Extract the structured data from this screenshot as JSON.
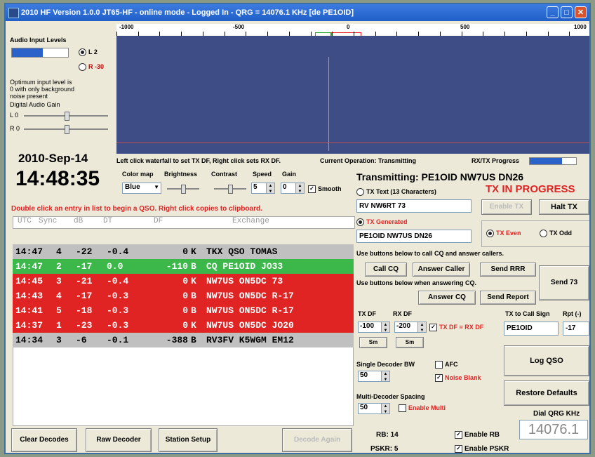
{
  "window": {
    "title": "2010 HF Version 1.0.0 JT65-HF - online mode - Logged In - QRG = 14076.1 KHz [de PE1OID]"
  },
  "audio": {
    "title": "Audio Input Levels",
    "left_label": "L 2",
    "right_label": "R -30",
    "level_l": 0.55,
    "optimum_text": "Optimum input level is 0 with only background noise present",
    "gain_title": "Digital Audio Gain",
    "gain_l_label": "L 0",
    "gain_r_label": "R 0"
  },
  "clock": {
    "date": "2010-Sep-14",
    "time": "14:48:35"
  },
  "ruler": {
    "labels": [
      "-1000",
      "-500",
      "0",
      "500",
      "1000"
    ]
  },
  "waterfall": {
    "hint": "Left click waterfall to set TX DF, Right click sets RX DF.",
    "operation": "Current Operation: Transmitting",
    "progress_label": "RX/TX Progress",
    "progress": 0.7
  },
  "controls": {
    "colormap_label": "Color map",
    "colormap_value": "Blue",
    "brightness_label": "Brightness",
    "contrast_label": "Contrast",
    "speed_label": "Speed",
    "speed_value": "5",
    "gain_label": "Gain",
    "gain_value": "0",
    "smooth_label": "Smooth"
  },
  "decode": {
    "instruction": "Double click an entry in list to begin a QSO. Right click copies to clipboard.",
    "headers": {
      "utc": "UTC",
      "sync": "Sync",
      "db": "dB",
      "dt": "DT",
      "df": "DF",
      "exchange": "Exchange"
    },
    "rows": [
      {
        "utc": "14:47",
        "sync": "4",
        "db": "-22",
        "dt": "-0.4",
        "df": "0",
        "mode": "K",
        "exchange": "TKX QSO TOMAS",
        "color": "#c0c0c0"
      },
      {
        "utc": "14:47",
        "sync": "2",
        "db": "-17",
        "dt": "0.0",
        "df": "-110",
        "mode": "B",
        "exchange": "CQ PE1OID JO33",
        "color": "#3cb84a"
      },
      {
        "utc": "14:45",
        "sync": "3",
        "db": "-21",
        "dt": "-0.4",
        "df": "0",
        "mode": "K",
        "exchange": "NW7US ON5DC 73",
        "color": "#e02424"
      },
      {
        "utc": "14:43",
        "sync": "4",
        "db": "-17",
        "dt": "-0.3",
        "df": "0",
        "mode": "B",
        "exchange": "NW7US ON5DC R-17",
        "color": "#e02424"
      },
      {
        "utc": "14:41",
        "sync": "5",
        "db": "-18",
        "dt": "-0.3",
        "df": "0",
        "mode": "B",
        "exchange": "NW7US ON5DC R-17",
        "color": "#e02424"
      },
      {
        "utc": "14:37",
        "sync": "1",
        "db": "-23",
        "dt": "-0.3",
        "df": "0",
        "mode": "K",
        "exchange": "NW7US ON5DC JO20",
        "color": "#e02424"
      },
      {
        "utc": "14:34",
        "sync": "3",
        "db": "-6",
        "dt": "-0.1",
        "df": "-388",
        "mode": "B",
        "exchange": "RV3FV K5WGM EM12",
        "color": "#c0c0c0"
      }
    ]
  },
  "tx": {
    "status": "Transmitting: PE1OID NW7US DN26",
    "in_progress": "TX IN PROGRESS",
    "text_label": "TX Text (13 Characters)",
    "text_value": "RV NW6RT 73",
    "enable_tx": "Enable TX",
    "halt_tx": "Halt TX",
    "generated_label": "TX Generated",
    "generated_value": "PE1OID NW7US DN26",
    "even_label": "TX Even",
    "odd_label": "TX Odd"
  },
  "qso": {
    "cq_hint": "Use buttons below to call CQ and answer callers.",
    "call_cq": "Call CQ",
    "answer_caller": "Answer Caller",
    "send_rrr": "Send RRR",
    "answer_hint": "Use buttons below when answering CQ.",
    "send73": "Send 73",
    "answer_cq": "Answer CQ",
    "send_report": "Send Report"
  },
  "df": {
    "tx_label": "TX DF",
    "rx_label": "RX DF",
    "tx_value": "-100",
    "rx_value": "-200",
    "txrx_label": "TX DF = RX DF",
    "minus": "Sm",
    "plus": "Sm",
    "call_label": "TX to Call Sign",
    "call_value": "PE1OID",
    "rpt_label": "Rpt (-)",
    "rpt_value": "-17"
  },
  "decoder": {
    "single_bw_label": "Single Decoder BW",
    "single_bw_value": "50",
    "afc_label": "AFC",
    "noise_label": "Noise Blank",
    "multi_label": "Multi-Decoder Spacing",
    "multi_value": "50",
    "enable_multi": "Enable Multi"
  },
  "right": {
    "log_qso": "Log QSO",
    "restore": "Restore Defaults",
    "dial_label": "Dial QRG KHz",
    "dial_value": "14076.1"
  },
  "bottom": {
    "clear": "Clear Decodes",
    "raw": "Raw Decoder",
    "setup": "Station Setup",
    "decode_again": "Decode Again",
    "rb": "RB: 14",
    "pskr": "PSKR: 5",
    "enable_rb": "Enable RB",
    "enable_pskr": "Enable PSKR"
  }
}
